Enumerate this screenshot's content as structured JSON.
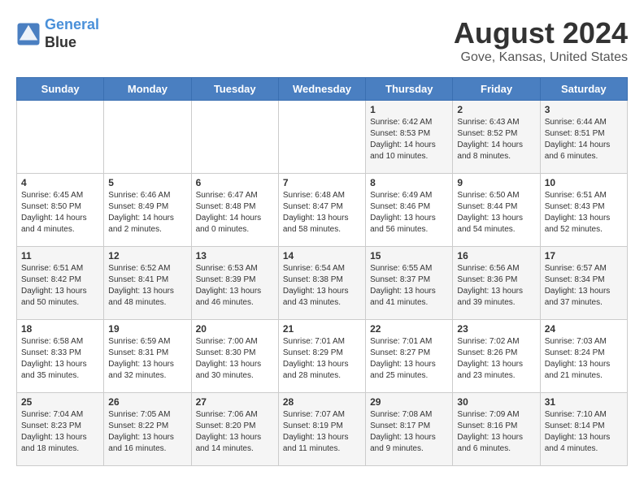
{
  "header": {
    "logo_line1": "General",
    "logo_line2": "Blue",
    "title": "August 2024",
    "location": "Gove, Kansas, United States"
  },
  "days_of_week": [
    "Sunday",
    "Monday",
    "Tuesday",
    "Wednesday",
    "Thursday",
    "Friday",
    "Saturday"
  ],
  "weeks": [
    [
      {
        "day": "",
        "content": ""
      },
      {
        "day": "",
        "content": ""
      },
      {
        "day": "",
        "content": ""
      },
      {
        "day": "",
        "content": ""
      },
      {
        "day": "1",
        "content": "Sunrise: 6:42 AM\nSunset: 8:53 PM\nDaylight: 14 hours\nand 10 minutes."
      },
      {
        "day": "2",
        "content": "Sunrise: 6:43 AM\nSunset: 8:52 PM\nDaylight: 14 hours\nand 8 minutes."
      },
      {
        "day": "3",
        "content": "Sunrise: 6:44 AM\nSunset: 8:51 PM\nDaylight: 14 hours\nand 6 minutes."
      }
    ],
    [
      {
        "day": "4",
        "content": "Sunrise: 6:45 AM\nSunset: 8:50 PM\nDaylight: 14 hours\nand 4 minutes."
      },
      {
        "day": "5",
        "content": "Sunrise: 6:46 AM\nSunset: 8:49 PM\nDaylight: 14 hours\nand 2 minutes."
      },
      {
        "day": "6",
        "content": "Sunrise: 6:47 AM\nSunset: 8:48 PM\nDaylight: 14 hours\nand 0 minutes."
      },
      {
        "day": "7",
        "content": "Sunrise: 6:48 AM\nSunset: 8:47 PM\nDaylight: 13 hours\nand 58 minutes."
      },
      {
        "day": "8",
        "content": "Sunrise: 6:49 AM\nSunset: 8:46 PM\nDaylight: 13 hours\nand 56 minutes."
      },
      {
        "day": "9",
        "content": "Sunrise: 6:50 AM\nSunset: 8:44 PM\nDaylight: 13 hours\nand 54 minutes."
      },
      {
        "day": "10",
        "content": "Sunrise: 6:51 AM\nSunset: 8:43 PM\nDaylight: 13 hours\nand 52 minutes."
      }
    ],
    [
      {
        "day": "11",
        "content": "Sunrise: 6:51 AM\nSunset: 8:42 PM\nDaylight: 13 hours\nand 50 minutes."
      },
      {
        "day": "12",
        "content": "Sunrise: 6:52 AM\nSunset: 8:41 PM\nDaylight: 13 hours\nand 48 minutes."
      },
      {
        "day": "13",
        "content": "Sunrise: 6:53 AM\nSunset: 8:39 PM\nDaylight: 13 hours\nand 46 minutes."
      },
      {
        "day": "14",
        "content": "Sunrise: 6:54 AM\nSunset: 8:38 PM\nDaylight: 13 hours\nand 43 minutes."
      },
      {
        "day": "15",
        "content": "Sunrise: 6:55 AM\nSunset: 8:37 PM\nDaylight: 13 hours\nand 41 minutes."
      },
      {
        "day": "16",
        "content": "Sunrise: 6:56 AM\nSunset: 8:36 PM\nDaylight: 13 hours\nand 39 minutes."
      },
      {
        "day": "17",
        "content": "Sunrise: 6:57 AM\nSunset: 8:34 PM\nDaylight: 13 hours\nand 37 minutes."
      }
    ],
    [
      {
        "day": "18",
        "content": "Sunrise: 6:58 AM\nSunset: 8:33 PM\nDaylight: 13 hours\nand 35 minutes."
      },
      {
        "day": "19",
        "content": "Sunrise: 6:59 AM\nSunset: 8:31 PM\nDaylight: 13 hours\nand 32 minutes."
      },
      {
        "day": "20",
        "content": "Sunrise: 7:00 AM\nSunset: 8:30 PM\nDaylight: 13 hours\nand 30 minutes."
      },
      {
        "day": "21",
        "content": "Sunrise: 7:01 AM\nSunset: 8:29 PM\nDaylight: 13 hours\nand 28 minutes."
      },
      {
        "day": "22",
        "content": "Sunrise: 7:01 AM\nSunset: 8:27 PM\nDaylight: 13 hours\nand 25 minutes."
      },
      {
        "day": "23",
        "content": "Sunrise: 7:02 AM\nSunset: 8:26 PM\nDaylight: 13 hours\nand 23 minutes."
      },
      {
        "day": "24",
        "content": "Sunrise: 7:03 AM\nSunset: 8:24 PM\nDaylight: 13 hours\nand 21 minutes."
      }
    ],
    [
      {
        "day": "25",
        "content": "Sunrise: 7:04 AM\nSunset: 8:23 PM\nDaylight: 13 hours\nand 18 minutes."
      },
      {
        "day": "26",
        "content": "Sunrise: 7:05 AM\nSunset: 8:22 PM\nDaylight: 13 hours\nand 16 minutes."
      },
      {
        "day": "27",
        "content": "Sunrise: 7:06 AM\nSunset: 8:20 PM\nDaylight: 13 hours\nand 14 minutes."
      },
      {
        "day": "28",
        "content": "Sunrise: 7:07 AM\nSunset: 8:19 PM\nDaylight: 13 hours\nand 11 minutes."
      },
      {
        "day": "29",
        "content": "Sunrise: 7:08 AM\nSunset: 8:17 PM\nDaylight: 13 hours\nand 9 minutes."
      },
      {
        "day": "30",
        "content": "Sunrise: 7:09 AM\nSunset: 8:16 PM\nDaylight: 13 hours\nand 6 minutes."
      },
      {
        "day": "31",
        "content": "Sunrise: 7:10 AM\nSunset: 8:14 PM\nDaylight: 13 hours\nand 4 minutes."
      }
    ]
  ]
}
